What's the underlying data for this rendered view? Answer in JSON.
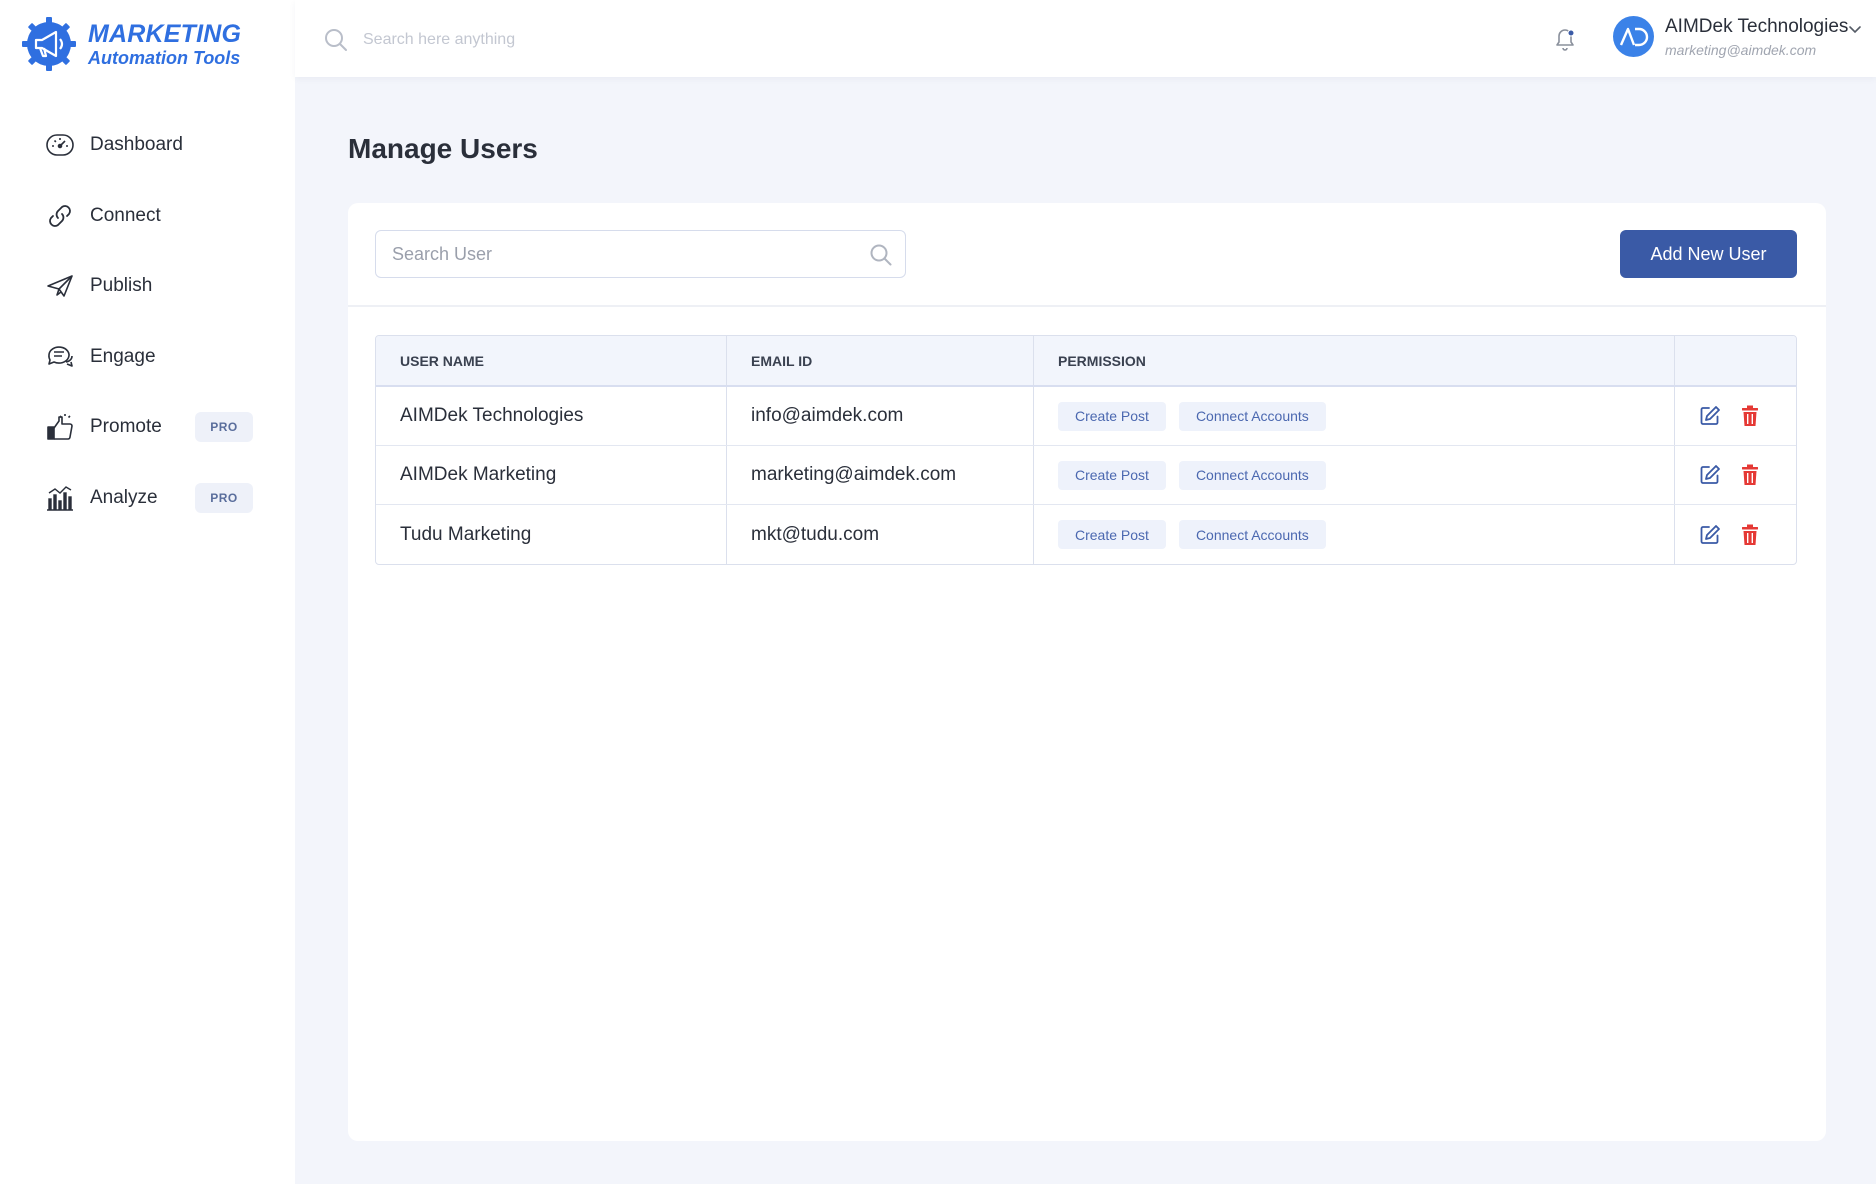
{
  "brand": {
    "line1": "MARKETING",
    "line2": "Automation Tools",
    "color": "#2f6fe0"
  },
  "sidebar": {
    "items": [
      {
        "label": "Dashboard",
        "icon": "dashboard-gauge-icon"
      },
      {
        "label": "Connect",
        "icon": "link-icon"
      },
      {
        "label": "Publish",
        "icon": "paper-plane-icon"
      },
      {
        "label": "Engage",
        "icon": "chat-bubbles-icon"
      },
      {
        "label": "Promote",
        "icon": "thumbs-up-icon",
        "badge": "PRO"
      },
      {
        "label": "Analyze",
        "icon": "bar-chart-icon",
        "badge": "PRO"
      }
    ]
  },
  "header": {
    "search_placeholder": "Search here anything",
    "account_name": "AIMDek Technologies",
    "account_email": "marketing@aimdek.com",
    "avatar_initials": "AD"
  },
  "main": {
    "title": "Manage Users",
    "search_user_placeholder": "Search User",
    "add_button_label": "Add New User",
    "table": {
      "columns": [
        "USER NAME",
        "EMAIL ID",
        "PERMISSION",
        ""
      ],
      "rows": [
        {
          "name": "AIMDek Technologies",
          "email": "info@aimdek.com",
          "permissions": [
            "Create Post",
            "Connect Accounts"
          ]
        },
        {
          "name": "AIMDek Marketing",
          "email": "marketing@aimdek.com",
          "permissions": [
            "Create Post",
            "Connect Accounts"
          ]
        },
        {
          "name": "Tudu Marketing",
          "email": "mkt@tudu.com",
          "permissions": [
            "Create Post",
            "Connect Accounts"
          ]
        }
      ]
    }
  },
  "colors": {
    "accent": "#3a5aa6",
    "delete": "#e53935",
    "edit": "#3a5aa6",
    "background": "#f3f5fb"
  }
}
